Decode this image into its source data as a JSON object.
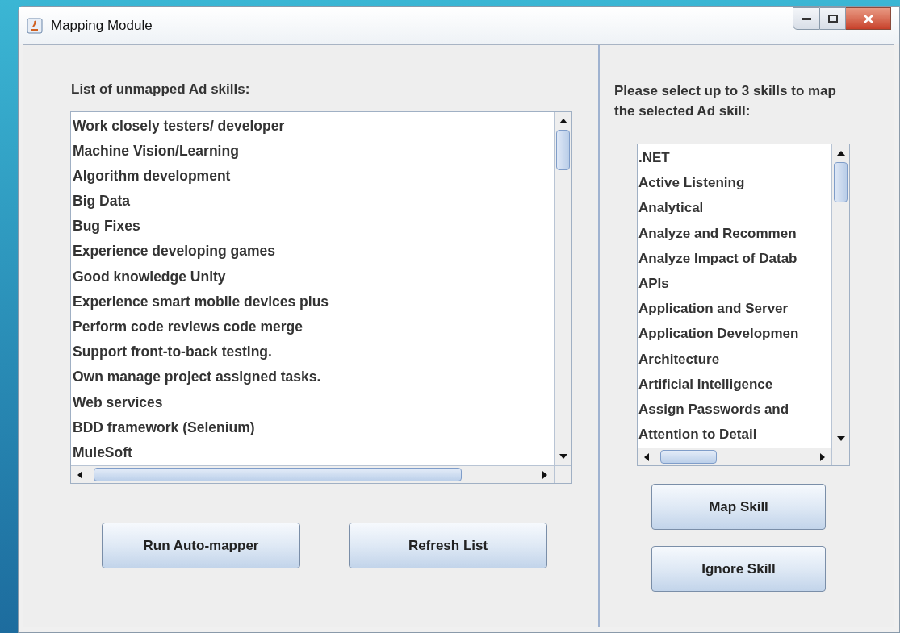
{
  "window": {
    "title": "Mapping Module"
  },
  "unmapped": {
    "label": "List of unmapped Ad skills:",
    "items": [
      "Work closely testers/ developer",
      "Machine Vision/Learning",
      "Algorithm development",
      "Big Data",
      "Bug Fixes",
      "Experience developing games",
      "Good knowledge Unity",
      "Experience smart mobile devices plus",
      "Perform code reviews code merge",
      "Support front-to-back testing.",
      "Own manage project assigned tasks.",
      "Web services",
      "BDD framework (Selenium)",
      "MuleSoft"
    ]
  },
  "left_buttons": [
    "Run Auto-mapper",
    "Refresh List"
  ],
  "skills": {
    "label": "Please select up to 3 skills to map the selected Ad skill:",
    "items": [
      ".NET",
      "Active Listening",
      "Analytical",
      "Analyze and Recommen",
      "Analyze Impact of Datab",
      "APIs",
      "Application and Server",
      "Application Developmen",
      "Architecture",
      "Artificial Intelligence",
      "Assign Passwords and",
      "Attention to Detail"
    ]
  },
  "right_buttons": [
    "Map Skill",
    "Ignore Skill"
  ]
}
